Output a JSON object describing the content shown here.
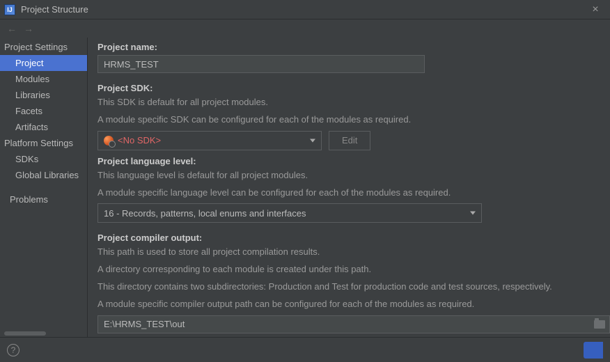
{
  "window": {
    "title": "Project Structure",
    "app_badge": "IJ"
  },
  "sidebar": {
    "groups": [
      {
        "label": "Project Settings",
        "items": [
          "Project",
          "Modules",
          "Libraries",
          "Facets",
          "Artifacts"
        ]
      },
      {
        "label": "Platform Settings",
        "items": [
          "SDKs",
          "Global Libraries"
        ]
      }
    ],
    "extra": [
      "Problems"
    ],
    "selected": "Project"
  },
  "project": {
    "name_label": "Project name:",
    "name_value": "HRMS_TEST",
    "sdk_label": "Project SDK:",
    "sdk_desc1": "This SDK is default for all project modules.",
    "sdk_desc2": "A module specific SDK can be configured for each of the modules as required.",
    "sdk_value": "<No SDK>",
    "edit_label": "Edit",
    "lang_label": "Project language level:",
    "lang_desc1": "This language level is default for all project modules.",
    "lang_desc2": "A module specific language level can be configured for each of the modules as required.",
    "lang_value": "16 - Records, patterns, local enums and interfaces",
    "out_label": "Project compiler output:",
    "out_desc1": "This path is used to store all project compilation results.",
    "out_desc2": "A directory corresponding to each module is created under this path.",
    "out_desc3": "This directory contains two subdirectories: Production and Test for production code and test sources, respectively.",
    "out_desc4": "A module specific compiler output path can be configured for each of the modules as required.",
    "out_value": "E:\\HRMS_TEST\\out"
  }
}
